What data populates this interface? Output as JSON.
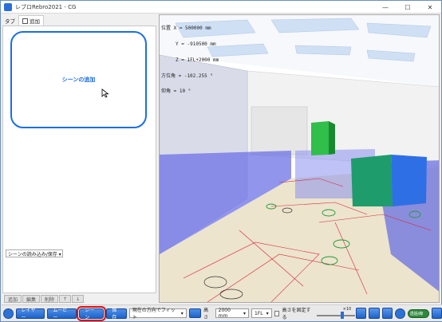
{
  "window": {
    "title": "レブロRebro2021 - CG",
    "controls": [
      "—",
      "☐",
      "✕"
    ]
  },
  "left_panel": {
    "tabs": [
      "タブ",
      "追加"
    ],
    "add_scene_label": "シーンの追加",
    "save_select": "シーンの読み込み/保存 ▾",
    "bottom_buttons": [
      "追加",
      "編集",
      "削除",
      "↑",
      "↓"
    ]
  },
  "viewport": {
    "info_lines": [
      "位置 X = 500000 mm",
      "     Y = -910500 mm",
      "     Z = 1FL+2000 mm",
      "方位角 = -102.255 °",
      "仰角 = 10 °"
    ]
  },
  "toolbar": {
    "layer_label": "レイヤー",
    "movie_label": "ムービー",
    "scene_label": "シーン",
    "save_image_label": "保存",
    "fit_select": "現在の方向でフィット",
    "height_label": "高さ",
    "height_value": "2000 mm",
    "floor_value": "1FL",
    "fix_height_label": "高さを固定する",
    "zoom_label": "×10",
    "toggle_label": "透過/線",
    "colors": {
      "accent_blue": "#1c6ee3",
      "selected_outline": "#e01010"
    }
  }
}
